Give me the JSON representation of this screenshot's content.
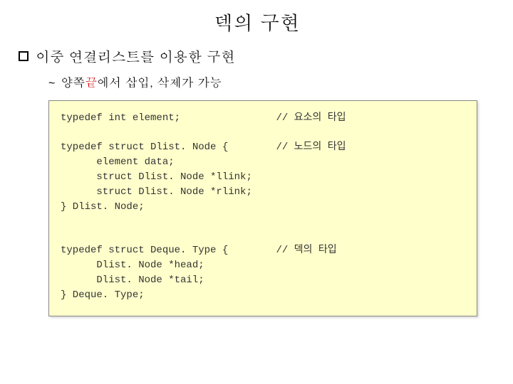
{
  "title": "덱의 구현",
  "bullet1": "이중 연결리스트를 이용한 구현",
  "subbullet_prefix": "양쪽",
  "subbullet_highlight": "끝",
  "subbullet_suffix": "에서 삽입, 삭제가 가능",
  "code": {
    "l1": "typedef int element;                // 요소의 타입",
    "l2": "typedef struct Dlist. Node {        // 노드의 타입",
    "l3": "      element data;",
    "l4": "      struct Dlist. Node *llink;",
    "l5": "      struct Dlist. Node *rlink;",
    "l6": "} Dlist. Node;",
    "l7": "typedef struct Deque. Type {        // 덱의 타입",
    "l8": "      Dlist. Node *head;",
    "l9": "      Dlist. Node *tail;",
    "l10": "} Deque. Type;"
  }
}
